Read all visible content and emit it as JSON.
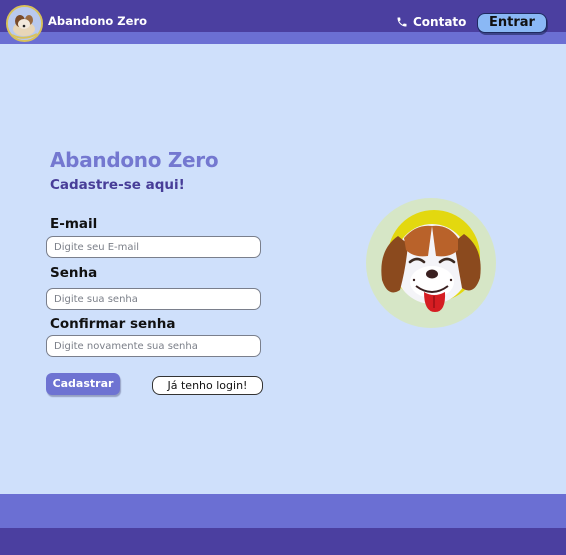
{
  "header": {
    "brand": "Abandono Zero",
    "contact_label": "Contato",
    "login_button": "Entrar"
  },
  "form": {
    "title": "Abandono Zero",
    "subtitle": "Cadastre-se aqui!",
    "email_label": "E-mail",
    "email_placeholder": "Digite seu E-mail",
    "password_label": "Senha",
    "password_placeholder": "Digite sua senha",
    "confirm_label": "Confirmar senha",
    "confirm_placeholder": "Digite novamente sua senha",
    "signup_button": "Cadastrar",
    "has_login_button": "Já tenho login!"
  },
  "colors": {
    "background": "#cfe0fb",
    "header_dark": "#4b3fa0",
    "header_light": "#6b6fd3",
    "accent": "#7478d0",
    "login_button_bg": "#8ab8f5"
  },
  "icons": {
    "logo": "dog-logo-icon",
    "contact": "phone-icon",
    "illustration": "dog-face-illustration"
  }
}
